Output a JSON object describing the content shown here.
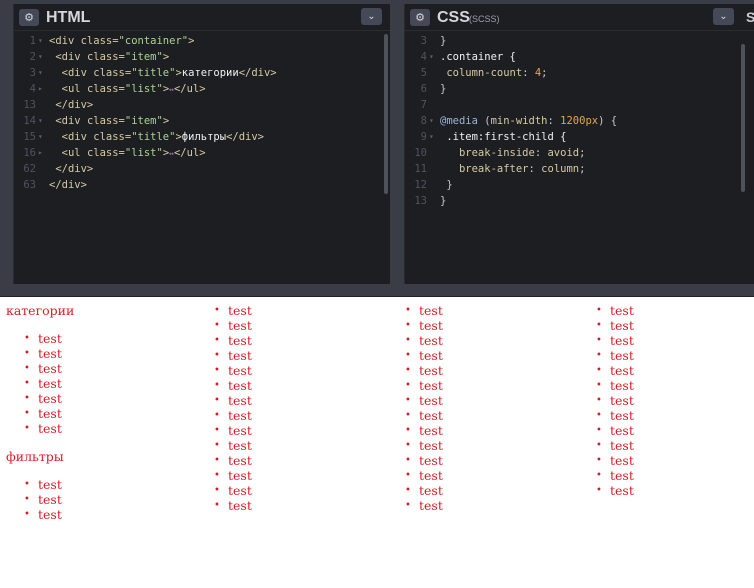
{
  "html_pane": {
    "title": "HTML",
    "gear_icon": "⚙",
    "collapse_icon": "⌄",
    "lines": [
      {
        "ln": "1",
        "fold": "▾",
        "parts": [
          {
            "c": "tag",
            "t": "<div "
          },
          {
            "c": "attr",
            "t": "class="
          },
          {
            "c": "str",
            "t": "\"container\""
          },
          {
            "c": "tag",
            "t": ">"
          }
        ]
      },
      {
        "ln": "2",
        "fold": "▾",
        "parts": [
          {
            "c": "tag",
            "t": " <div "
          },
          {
            "c": "attr",
            "t": "class="
          },
          {
            "c": "str",
            "t": "\"item\""
          },
          {
            "c": "tag",
            "t": ">"
          }
        ]
      },
      {
        "ln": "3",
        "fold": "▾",
        "parts": [
          {
            "c": "tag",
            "t": "  <div "
          },
          {
            "c": "attr",
            "t": "class="
          },
          {
            "c": "str",
            "t": "\"title\""
          },
          {
            "c": "tag",
            "t": ">"
          },
          {
            "c": "txt",
            "t": "категории"
          },
          {
            "c": "tag",
            "t": "</div>"
          }
        ]
      },
      {
        "ln": "4",
        "fold": "▸",
        "parts": [
          {
            "c": "tag",
            "t": "  <ul "
          },
          {
            "c": "attr",
            "t": "class="
          },
          {
            "c": "str",
            "t": "\"list\""
          },
          {
            "c": "tag",
            "t": ">"
          },
          {
            "c": "dots",
            "t": "↔"
          },
          {
            "c": "tag",
            "t": "</ul>"
          }
        ]
      },
      {
        "ln": "13",
        "fold": "",
        "parts": [
          {
            "c": "tag",
            "t": " </div>"
          }
        ]
      },
      {
        "ln": "14",
        "fold": "▾",
        "parts": [
          {
            "c": "tag",
            "t": " <div "
          },
          {
            "c": "attr",
            "t": "class="
          },
          {
            "c": "str",
            "t": "\"item\""
          },
          {
            "c": "tag",
            "t": ">"
          }
        ]
      },
      {
        "ln": "15",
        "fold": "▾",
        "parts": [
          {
            "c": "tag",
            "t": "  <div "
          },
          {
            "c": "attr",
            "t": "class="
          },
          {
            "c": "str",
            "t": "\"title\""
          },
          {
            "c": "tag",
            "t": ">"
          },
          {
            "c": "txt",
            "t": "фильтры"
          },
          {
            "c": "tag",
            "t": "</div>"
          }
        ]
      },
      {
        "ln": "16",
        "fold": "▸",
        "parts": [
          {
            "c": "tag",
            "t": "  <ul "
          },
          {
            "c": "attr",
            "t": "class="
          },
          {
            "c": "str",
            "t": "\"list\""
          },
          {
            "c": "tag",
            "t": ">"
          },
          {
            "c": "dots",
            "t": "↔"
          },
          {
            "c": "tag",
            "t": "</ul>"
          }
        ]
      },
      {
        "ln": "62",
        "fold": "",
        "parts": [
          {
            "c": "tag",
            "t": " </div>"
          }
        ]
      },
      {
        "ln": "63",
        "fold": "",
        "parts": [
          {
            "c": "tag",
            "t": "</div>"
          }
        ]
      }
    ]
  },
  "css_pane": {
    "title": "CSS",
    "subtitle": "(SCSS)",
    "gear_icon": "⚙",
    "collapse_icon": "⌄",
    "edge_text": "S",
    "lines": [
      {
        "ln": "3",
        "fold": "",
        "parts": [
          {
            "c": "muted",
            "t": "}"
          }
        ]
      },
      {
        "ln": "4",
        "fold": "▾",
        "parts": [
          {
            "c": "sel",
            "t": ".container {"
          }
        ]
      },
      {
        "ln": "5",
        "fold": "",
        "parts": [
          {
            "c": "prop",
            "t": " column-count"
          },
          {
            "c": "muted",
            "t": ": "
          },
          {
            "c": "num",
            "t": "4"
          },
          {
            "c": "muted",
            "t": ";"
          }
        ]
      },
      {
        "ln": "6",
        "fold": "",
        "parts": [
          {
            "c": "muted",
            "t": "}"
          }
        ]
      },
      {
        "ln": "7",
        "fold": "",
        "parts": []
      },
      {
        "ln": "8",
        "fold": "▾",
        "parts": [
          {
            "c": "kw",
            "t": "@media "
          },
          {
            "c": "muted",
            "t": "("
          },
          {
            "c": "prop",
            "t": "min-width"
          },
          {
            "c": "muted",
            "t": ": "
          },
          {
            "c": "num",
            "t": "1200px"
          },
          {
            "c": "muted",
            "t": ") {"
          }
        ]
      },
      {
        "ln": "9",
        "fold": "▾",
        "parts": [
          {
            "c": "sel",
            "t": " .item:first-child {"
          }
        ]
      },
      {
        "ln": "10",
        "fold": "",
        "parts": [
          {
            "c": "prop",
            "t": "   break-inside"
          },
          {
            "c": "muted",
            "t": ": "
          },
          {
            "c": "prop",
            "t": "avoid"
          },
          {
            "c": "muted",
            "t": ";"
          }
        ]
      },
      {
        "ln": "11",
        "fold": "",
        "parts": [
          {
            "c": "prop",
            "t": "   break-after"
          },
          {
            "c": "muted",
            "t": ": "
          },
          {
            "c": "prop",
            "t": "column"
          },
          {
            "c": "muted",
            "t": ";"
          }
        ]
      },
      {
        "ln": "12",
        "fold": "",
        "parts": [
          {
            "c": "muted",
            "t": " }"
          }
        ]
      },
      {
        "ln": "13",
        "fold": "",
        "parts": [
          {
            "c": "muted",
            "t": "}"
          }
        ]
      }
    ]
  },
  "output": {
    "bullet": "•",
    "col1": {
      "title1": "категории",
      "list1": [
        "test",
        "test",
        "test",
        "test",
        "test",
        "test",
        "test"
      ],
      "title2": "фильтры",
      "list2": [
        "test",
        "test",
        "test"
      ]
    },
    "col2": [
      "test",
      "test",
      "test",
      "test",
      "test",
      "test",
      "test",
      "test",
      "test",
      "test",
      "test",
      "test",
      "test",
      "test"
    ],
    "col3": [
      "test",
      "test",
      "test",
      "test",
      "test",
      "test",
      "test",
      "test",
      "test",
      "test",
      "test",
      "test",
      "test",
      "test"
    ],
    "col4": [
      "test",
      "test",
      "test",
      "test",
      "test",
      "test",
      "test",
      "test",
      "test",
      "test",
      "test",
      "test",
      "test"
    ]
  }
}
